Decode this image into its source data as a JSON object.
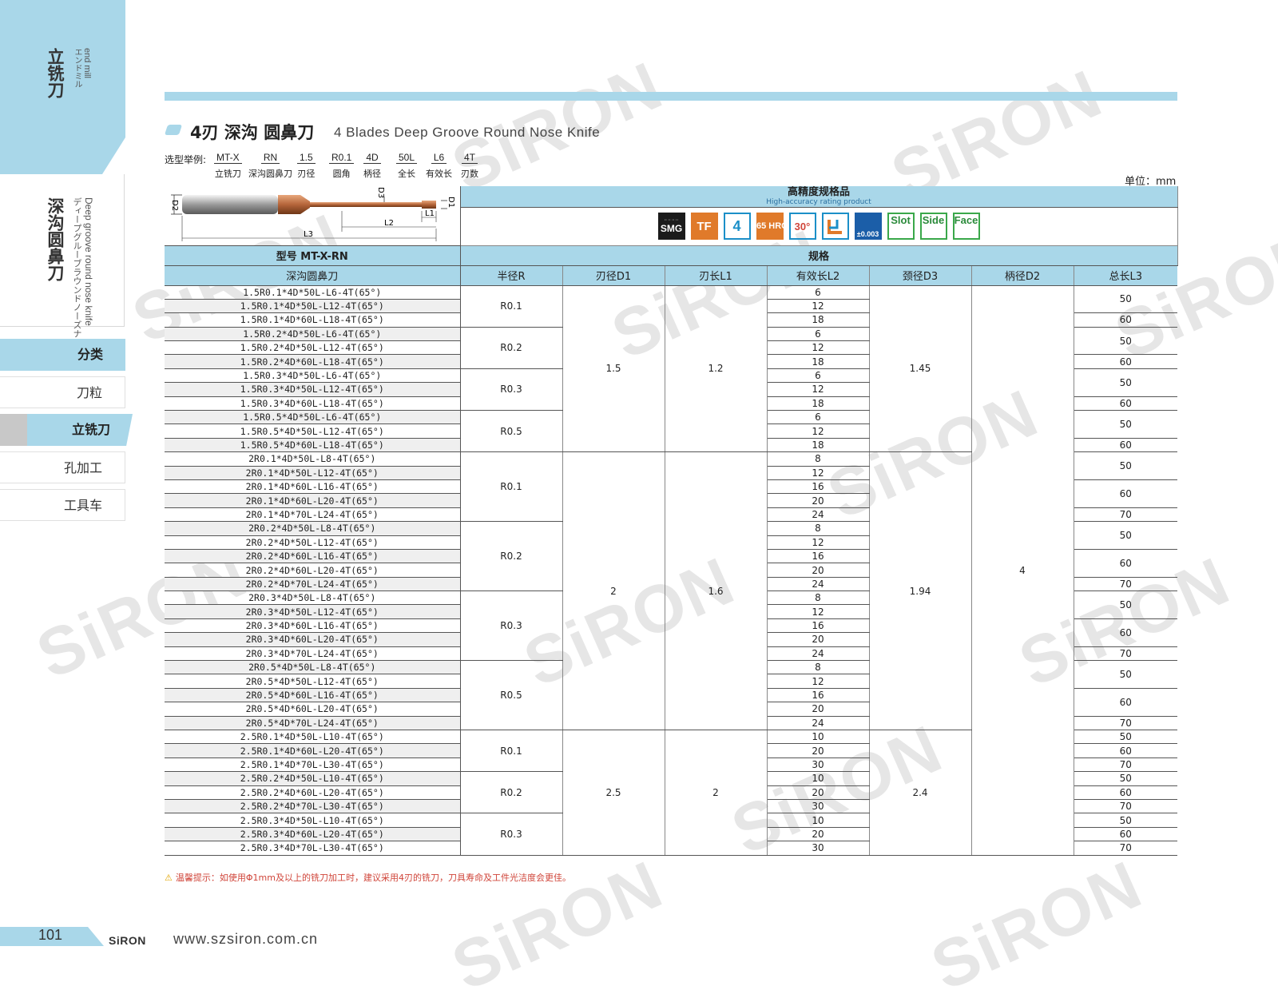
{
  "watermark": "SiRON",
  "sidebar": {
    "category_cn": "立铣刀",
    "category_en": "end mill",
    "category_jp": "エンドミル",
    "product_cn": "深沟圆鼻刀",
    "product_en": "Deep groove round nose knife",
    "product_jp": "ディープグルーブラウンドノーズナイフ",
    "nav": [
      {
        "label": "分类",
        "state": "header"
      },
      {
        "label": "刀粒",
        "state": "plain"
      },
      {
        "label": "立铣刀",
        "state": "active"
      },
      {
        "label": "孔加工",
        "state": "plain"
      },
      {
        "label": "工具车",
        "state": "plain"
      }
    ]
  },
  "header": {
    "title_cn": "4刃 深沟 圆鼻刀",
    "title_en": "4 Blades Deep Groove Round Nose Knife",
    "selection_label": "选型举例:",
    "selection": [
      {
        "code": "MT-X",
        "desc": "立铣刀"
      },
      {
        "code": "RN",
        "desc": "深沟圆鼻刀"
      },
      {
        "code": "1.5",
        "desc": "刃径"
      },
      {
        "code": "R0.1",
        "desc": "圆角"
      },
      {
        "code": "4D",
        "desc": "柄径"
      },
      {
        "code": "50L",
        "desc": "全长"
      },
      {
        "code": "L6",
        "desc": "有效长"
      },
      {
        "code": "4T",
        "desc": "刃数"
      }
    ],
    "unit": "单位：mm"
  },
  "diagram": {
    "d2": "D2",
    "d3": "D3",
    "d1": "D1",
    "l1": "L1",
    "l2": "L2",
    "l3": "L3"
  },
  "spec_banner": {
    "title": "高精度规格品",
    "subtitle": "High-accuracy rating product"
  },
  "badges": [
    {
      "name": "smg",
      "label": "SMG"
    },
    {
      "name": "tf",
      "label": "TF"
    },
    {
      "name": "4-flute",
      "label": "4"
    },
    {
      "name": "hrc65",
      "label": "≤65 HRC"
    },
    {
      "name": "helix30",
      "label": "30°"
    },
    {
      "name": "corner",
      "label": ""
    },
    {
      "name": "tolerance",
      "label": "±0.003"
    },
    {
      "name": "slot",
      "label": "Slot"
    },
    {
      "name": "side",
      "label": "Side"
    },
    {
      "name": "face",
      "label": "Face"
    }
  ],
  "table": {
    "model_label": "型号  MT-X-RN",
    "spec_label": "规格",
    "columns": [
      "深沟圆鼻刀",
      "半径R",
      "刃径D1",
      "刃长L1",
      "有效长L2",
      "颈径D3",
      "柄径D2",
      "总长L3"
    ],
    "rows": [
      "1.5R0.1*4D*50L-L6-4T(65°)",
      "1.5R0.1*4D*50L-L12-4T(65°)",
      "1.5R0.1*4D*60L-L18-4T(65°)",
      "1.5R0.2*4D*50L-L6-4T(65°)",
      "1.5R0.2*4D*50L-L12-4T(65°)",
      "1.5R0.2*4D*60L-L18-4T(65°)",
      "1.5R0.3*4D*50L-L6-4T(65°)",
      "1.5R0.3*4D*50L-L12-4T(65°)",
      "1.5R0.3*4D*60L-L18-4T(65°)",
      "1.5R0.5*4D*50L-L6-4T(65°)",
      "1.5R0.5*4D*50L-L12-4T(65°)",
      "1.5R0.5*4D*60L-L18-4T(65°)",
      "2R0.1*4D*50L-L8-4T(65°)",
      "2R0.1*4D*50L-L12-4T(65°)",
      "2R0.1*4D*60L-L16-4T(65°)",
      "2R0.1*4D*60L-L20-4T(65°)",
      "2R0.1*4D*70L-L24-4T(65°)",
      "2R0.2*4D*50L-L8-4T(65°)",
      "2R0.2*4D*50L-L12-4T(65°)",
      "2R0.2*4D*60L-L16-4T(65°)",
      "2R0.2*4D*60L-L20-4T(65°)",
      "2R0.2*4D*70L-L24-4T(65°)",
      "2R0.3*4D*50L-L8-4T(65°)",
      "2R0.3*4D*50L-L12-4T(65°)",
      "2R0.3*4D*60L-L16-4T(65°)",
      "2R0.3*4D*60L-L20-4T(65°)",
      "2R0.3*4D*70L-L24-4T(65°)",
      "2R0.5*4D*50L-L8-4T(65°)",
      "2R0.5*4D*50L-L12-4T(65°)",
      "2R0.5*4D*60L-L16-4T(65°)",
      "2R0.5*4D*60L-L20-4T(65°)",
      "2R0.5*4D*70L-L24-4T(65°)",
      "2.5R0.1*4D*50L-L10-4T(65°)",
      "2.5R0.1*4D*60L-L20-4T(65°)",
      "2.5R0.1*4D*70L-L30-4T(65°)",
      "2.5R0.2*4D*50L-L10-4T(65°)",
      "2.5R0.2*4D*60L-L20-4T(65°)",
      "2.5R0.2*4D*70L-L30-4T(65°)",
      "2.5R0.3*4D*50L-L10-4T(65°)",
      "2.5R0.3*4D*60L-L20-4T(65°)",
      "2.5R0.3*4D*70L-L30-4T(65°)"
    ],
    "radius": [
      [
        "R0.1",
        3
      ],
      [
        "R0.2",
        3
      ],
      [
        "R0.3",
        3
      ],
      [
        "R0.5",
        3
      ],
      [
        "R0.1",
        5
      ],
      [
        "R0.2",
        5
      ],
      [
        "R0.3",
        5
      ],
      [
        "R0.5",
        5
      ],
      [
        "R0.1",
        3
      ],
      [
        "R0.2",
        3
      ],
      [
        "R0.3",
        3
      ]
    ],
    "d1": [
      [
        "1.5",
        12
      ],
      [
        "2",
        20
      ],
      [
        "2.5",
        9
      ]
    ],
    "l1": [
      [
        "1.2",
        12
      ],
      [
        "1.6",
        20
      ],
      [
        "2",
        9
      ]
    ],
    "l2": [
      [
        "6",
        1
      ],
      [
        "12",
        1
      ],
      [
        "18",
        1
      ],
      [
        "6",
        1
      ],
      [
        "12",
        1
      ],
      [
        "18",
        1
      ],
      [
        "6",
        1
      ],
      [
        "12",
        1
      ],
      [
        "18",
        1
      ],
      [
        "6",
        1
      ],
      [
        "12",
        1
      ],
      [
        "18",
        1
      ],
      [
        "8",
        1
      ],
      [
        "12",
        1
      ],
      [
        "16",
        1
      ],
      [
        "20",
        1
      ],
      [
        "24",
        1
      ],
      [
        "8",
        1
      ],
      [
        "12",
        1
      ],
      [
        "16",
        1
      ],
      [
        "20",
        1
      ],
      [
        "24",
        1
      ],
      [
        "8",
        1
      ],
      [
        "12",
        1
      ],
      [
        "16",
        1
      ],
      [
        "20",
        1
      ],
      [
        "24",
        1
      ],
      [
        "8",
        1
      ],
      [
        "12",
        1
      ],
      [
        "16",
        1
      ],
      [
        "20",
        1
      ],
      [
        "24",
        1
      ],
      [
        "10",
        1
      ],
      [
        "20",
        1
      ],
      [
        "30",
        1
      ],
      [
        "10",
        1
      ],
      [
        "20",
        1
      ],
      [
        "30",
        1
      ],
      [
        "10",
        1
      ],
      [
        "20",
        1
      ],
      [
        "30",
        1
      ]
    ],
    "d3": [
      [
        "1.45",
        12
      ],
      [
        "1.94",
        20
      ],
      [
        "2.4",
        9
      ]
    ],
    "d2": [
      [
        "4",
        41
      ]
    ],
    "l3": [
      [
        "50",
        2
      ],
      [
        "60",
        1
      ],
      [
        "50",
        2
      ],
      [
        "60",
        1
      ],
      [
        "50",
        2
      ],
      [
        "60",
        1
      ],
      [
        "50",
        2
      ],
      [
        "60",
        1
      ],
      [
        "50",
        2
      ],
      [
        "60",
        2
      ],
      [
        "70",
        1
      ],
      [
        "50",
        2
      ],
      [
        "60",
        2
      ],
      [
        "70",
        1
      ],
      [
        "50",
        2
      ],
      [
        "60",
        2
      ],
      [
        "70",
        1
      ],
      [
        "50",
        2
      ],
      [
        "60",
        2
      ],
      [
        "70",
        1
      ],
      [
        "50",
        1
      ],
      [
        "60",
        1
      ],
      [
        "70",
        1
      ],
      [
        "50",
        1
      ],
      [
        "60",
        1
      ],
      [
        "70",
        1
      ],
      [
        "50",
        1
      ],
      [
        "60",
        1
      ],
      [
        "70",
        1
      ]
    ]
  },
  "warning": "温馨提示：如使用Φ1mm及以上的铣刀加工时，建议采用4刃的铣刀，刀具寿命及工件光洁度会更佳。",
  "footer": {
    "page": "101",
    "brand": "SiRON",
    "website": "www.szsiron.com.cn"
  }
}
